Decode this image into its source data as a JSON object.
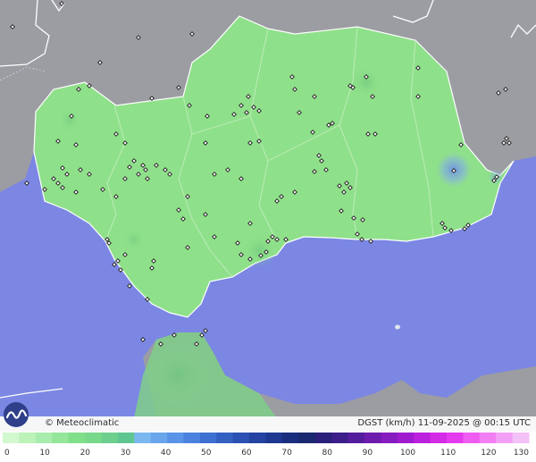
{
  "map": {
    "brand": "© Meteoclimatic",
    "caption": "DGST (km/h)  11-09-2025 @ 00:15 UTC",
    "station_icon": "diamond-station-icon",
    "logo_icon": "meteoclimatic-wave-logo-icon",
    "colors": {
      "sea": "#7b87e3",
      "foreign_land": "#9b9ba1",
      "region_land": "#8fe08a"
    }
  },
  "legend": {
    "ticks": [
      "0",
      "10",
      "20",
      "30",
      "40",
      "50",
      "60",
      "70",
      "80",
      "90",
      "100",
      "110",
      "120",
      "130"
    ],
    "colors": [
      "#d2f8cf",
      "#bdf2b8",
      "#a8ecae",
      "#94e69a",
      "#80e08a",
      "#79d98b",
      "#6ccf8e",
      "#5fc691",
      "#7bb8f0",
      "#6aa6ec",
      "#5a94e6",
      "#4b82dd",
      "#3e70d1",
      "#3460c2",
      "#2b51b2",
      "#2443a2",
      "#1e3791",
      "#1a2e80",
      "#1a286f",
      "#2a1f7a",
      "#3c1d8a",
      "#541c9c",
      "#6d1bad",
      "#861bbf",
      "#a01bd0",
      "#bb20de",
      "#d32be6",
      "#e43bee",
      "#ef5cf2",
      "#f27ef4",
      "#f2a0f6",
      "#f3c0f8"
    ]
  }
}
